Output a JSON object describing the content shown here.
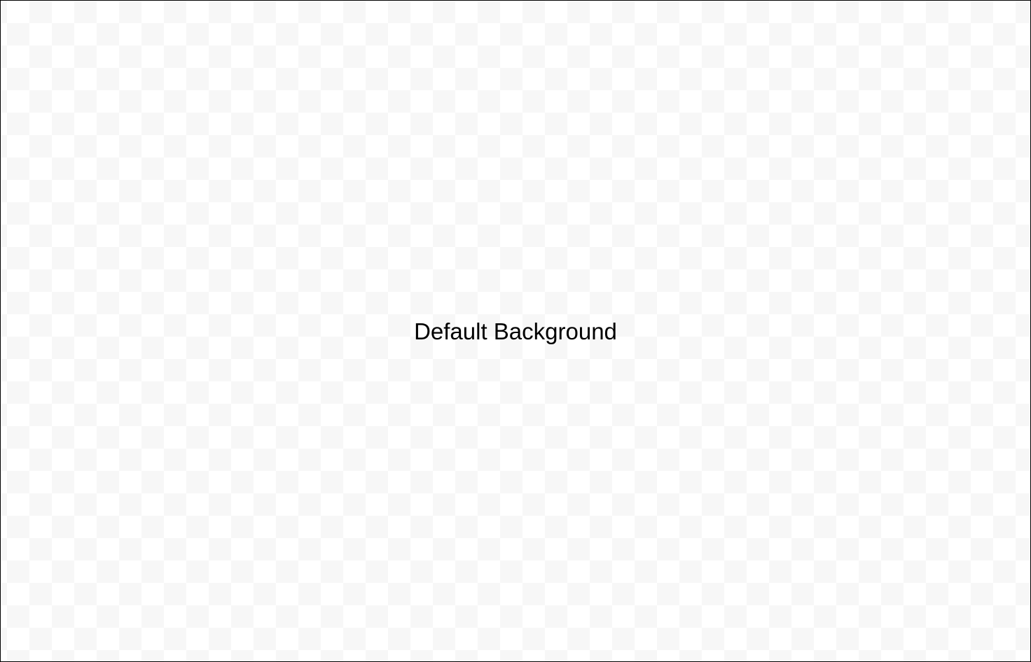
{
  "canvas": {
    "label": "Default Background",
    "checker_light": "#ffffff",
    "checker_dark": "#f7f7f7",
    "border_color": "#000000"
  }
}
